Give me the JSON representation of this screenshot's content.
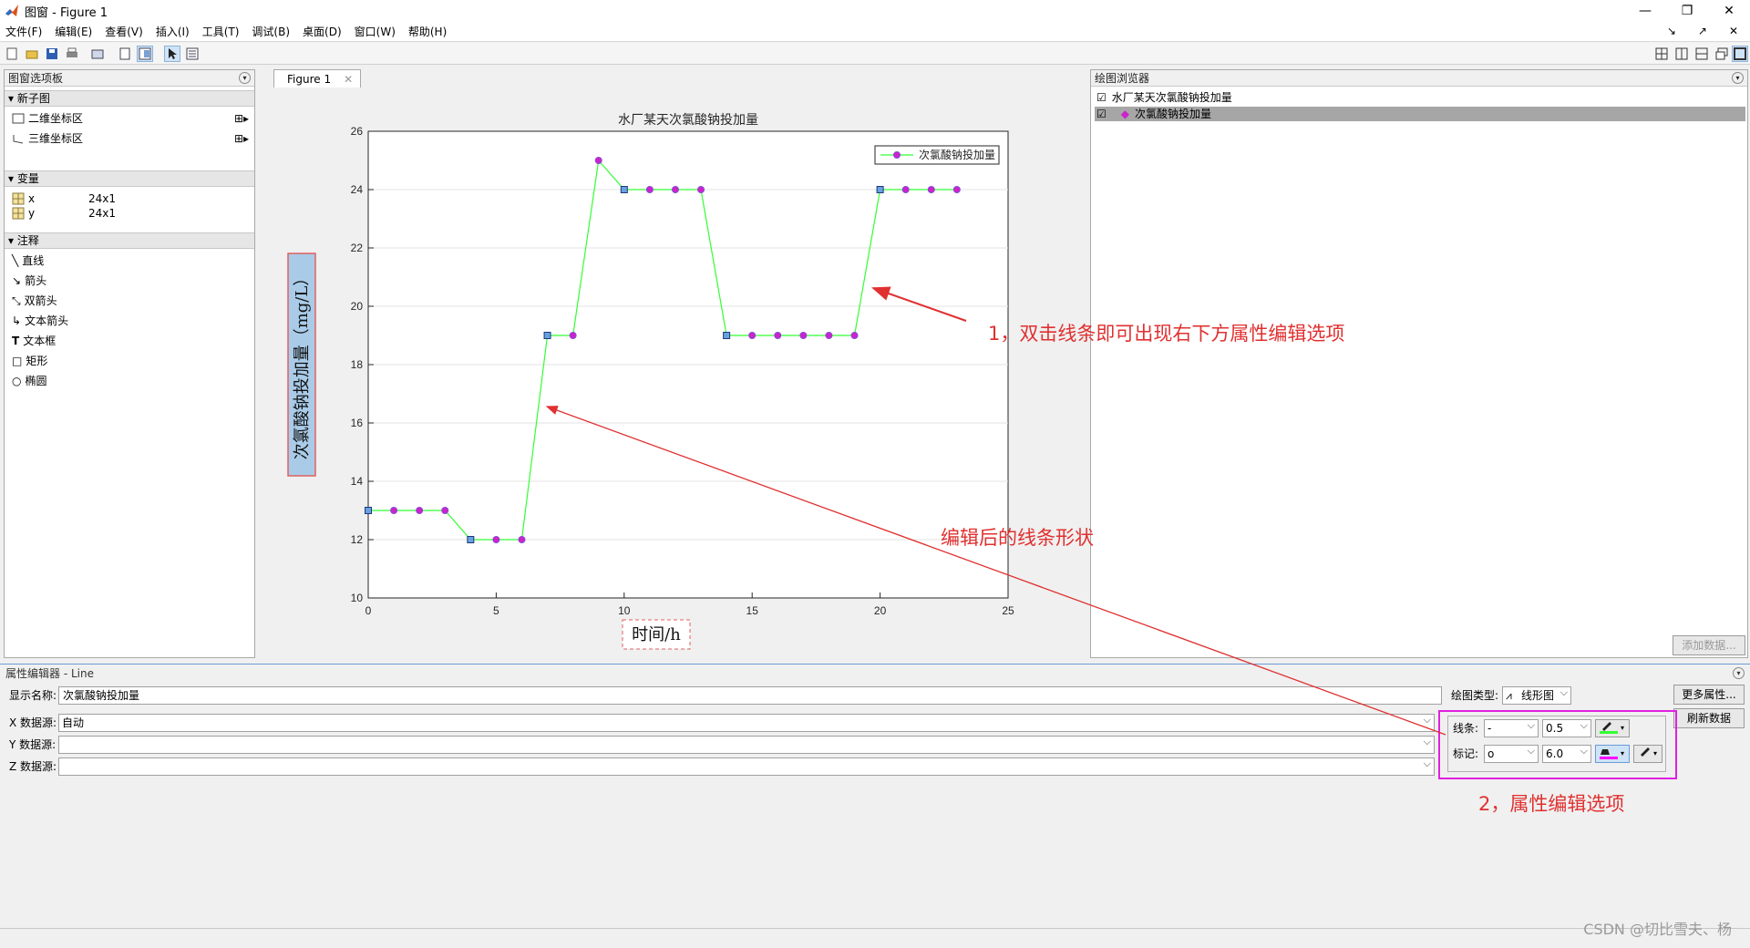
{
  "window": {
    "title": "图窗 - Figure 1",
    "minimize": "—",
    "restore": "❐",
    "close": "✕"
  },
  "menu": {
    "items": [
      "文件(F)",
      "编辑(E)",
      "查看(V)",
      "插入(I)",
      "工具(T)",
      "调试(B)",
      "桌面(D)",
      "窗口(W)",
      "帮助(H)"
    ]
  },
  "palette": {
    "title": "图窗选项板",
    "sections": {
      "new_subplot": "新子图",
      "variables": "变量",
      "annotations": "注释"
    },
    "subplots": [
      "二维坐标区",
      "三维坐标区"
    ],
    "variables": [
      {
        "name": "x",
        "size": "24x1"
      },
      {
        "name": "y",
        "size": "24x1"
      }
    ],
    "annotations": [
      "直线",
      "箭头",
      "双箭头",
      "文本箭头",
      "文本框",
      "矩形",
      "椭圆"
    ]
  },
  "figure_tab": {
    "label": "Figure 1"
  },
  "plot_browser": {
    "title": "绘图浏览器",
    "items": [
      {
        "label": "水厂某天次氯酸钠投加量",
        "checked": "☑"
      },
      {
        "label": "次氯酸钠投加量",
        "checked": "☑"
      }
    ],
    "add_data": "添加数据..."
  },
  "property_editor": {
    "title": "属性编辑器 - Line",
    "display_name_label": "显示名称:",
    "display_name": "次氯酸钠投加量",
    "x_label": "X 数据源:",
    "x_value": "自动",
    "y_label": "Y 数据源:",
    "z_label": "Z 数据源:",
    "plot_type_label": "绘图类型:",
    "plot_type": "线形图",
    "more_props": "更多属性...",
    "refresh": "刷新数据",
    "line_label": "线条:",
    "line_style": "-",
    "line_width": "0.5",
    "marker_label": "标记:",
    "marker_style": "o",
    "marker_size": "6.0"
  },
  "annotations_overlay": {
    "a1": "1，双击线条即可出现右下方属性编辑选项",
    "a2": "编辑后的线条形状",
    "a3": "2，属性编辑选项"
  },
  "watermark": "CSDN @切比雪夫、杨",
  "colors": {
    "line": "#33ff33",
    "marker_face": "#cc22cc",
    "annotation": "#e03030",
    "highlight_box": "#e020e0"
  },
  "chart_data": {
    "type": "line",
    "title": "水厂某天次氯酸钠投加量",
    "xlabel": "时间/h",
    "ylabel": "次氯酸钠投加量（mg/L）",
    "xlim": [
      0,
      25
    ],
    "ylim": [
      10,
      26
    ],
    "xticks": [
      0,
      5,
      10,
      15,
      20,
      25
    ],
    "yticks": [
      10,
      12,
      14,
      16,
      18,
      20,
      22,
      24,
      26
    ],
    "legend": "top-right",
    "grid": "horizontal",
    "series": [
      {
        "name": "次氯酸钠投加量",
        "x": [
          0,
          1,
          2,
          3,
          4,
          5,
          6,
          7,
          8,
          9,
          10,
          11,
          12,
          13,
          14,
          15,
          16,
          17,
          18,
          19,
          20,
          21,
          22,
          23
        ],
        "y": [
          13,
          13,
          13,
          13,
          12,
          12,
          12,
          19,
          19,
          25,
          24,
          24,
          24,
          24,
          19,
          19,
          19,
          19,
          19,
          19,
          24,
          24,
          24,
          24
        ]
      }
    ]
  }
}
